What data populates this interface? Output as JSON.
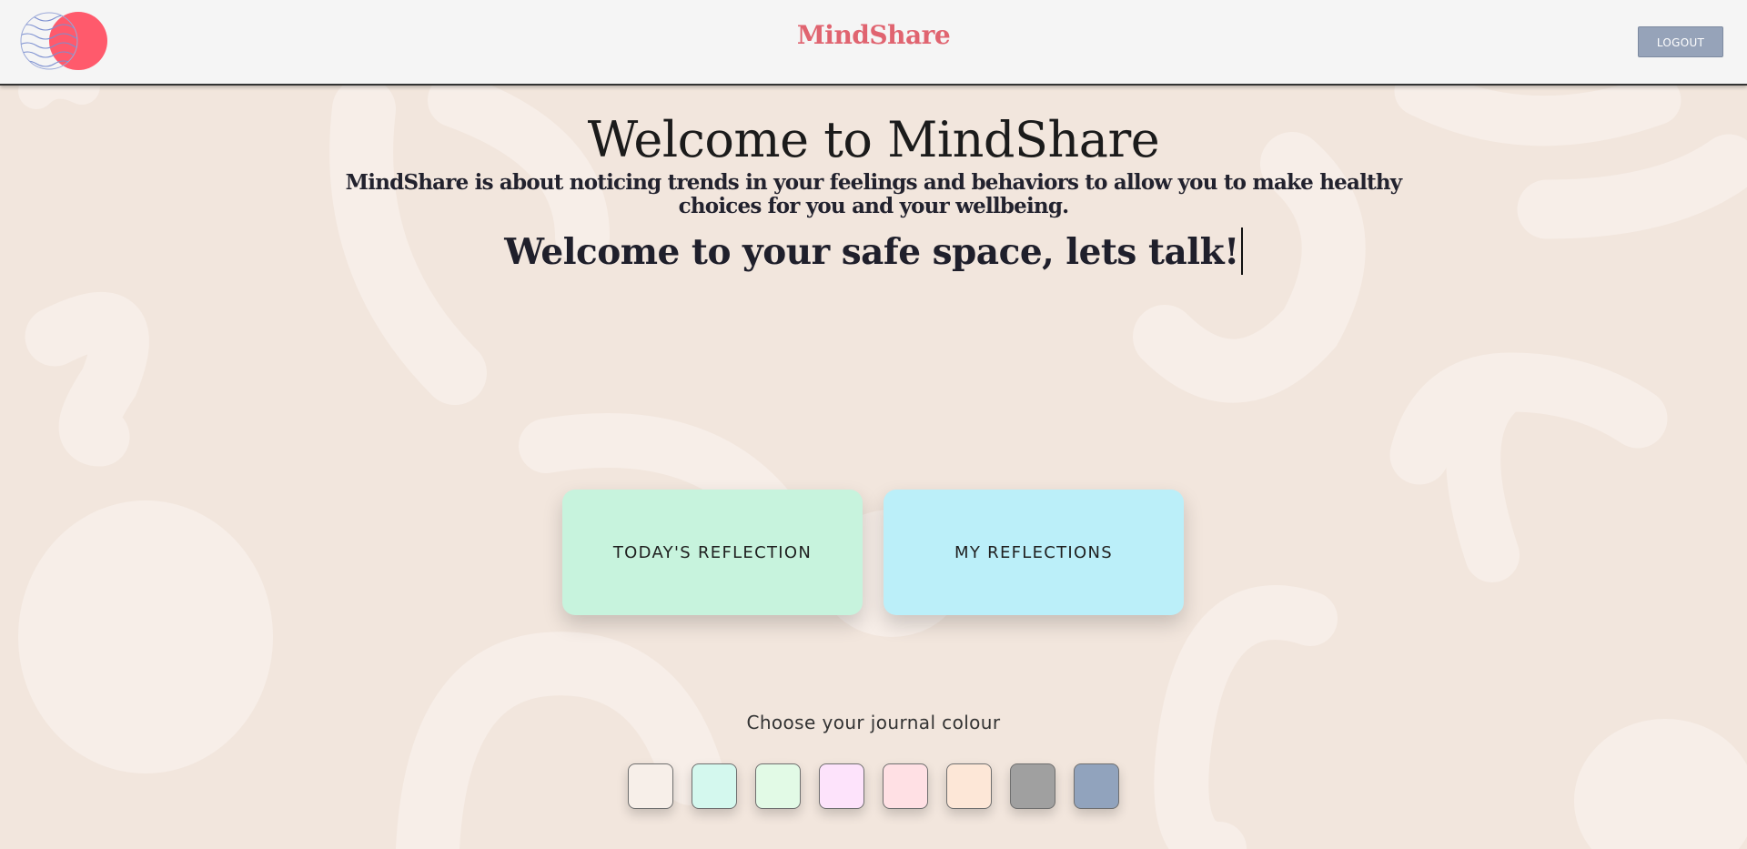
{
  "header": {
    "brand": "MindShare",
    "logout_label": "LOGOUT"
  },
  "hero": {
    "title": "Welcome to MindShare",
    "intro": "MindShare is about noticing trends in your feelings and behaviors to allow you to make healthy choices for you and your wellbeing.",
    "tagline": "Welcome to your safe space, lets talk!"
  },
  "actions": {
    "todays_reflection": "TODAY'S REFLECTION",
    "my_reflections": "MY REFLECTIONS"
  },
  "journal": {
    "label": "Choose your journal colour",
    "colours": [
      "#f7efe9",
      "#d4f8ee",
      "#e2fae6",
      "#fde3fb",
      "#ffe0e4",
      "#fde7d7",
      "#a0a0a0",
      "#91a3bd"
    ]
  },
  "colors": {
    "background": "#f2e6dd",
    "brand": "#e06470",
    "logout_button": "#96a3b9",
    "todays_card": "#c7f3dd",
    "my_card": "#bbeff9"
  },
  "icons": {
    "logo": "overlapping-circles-logo-icon"
  }
}
